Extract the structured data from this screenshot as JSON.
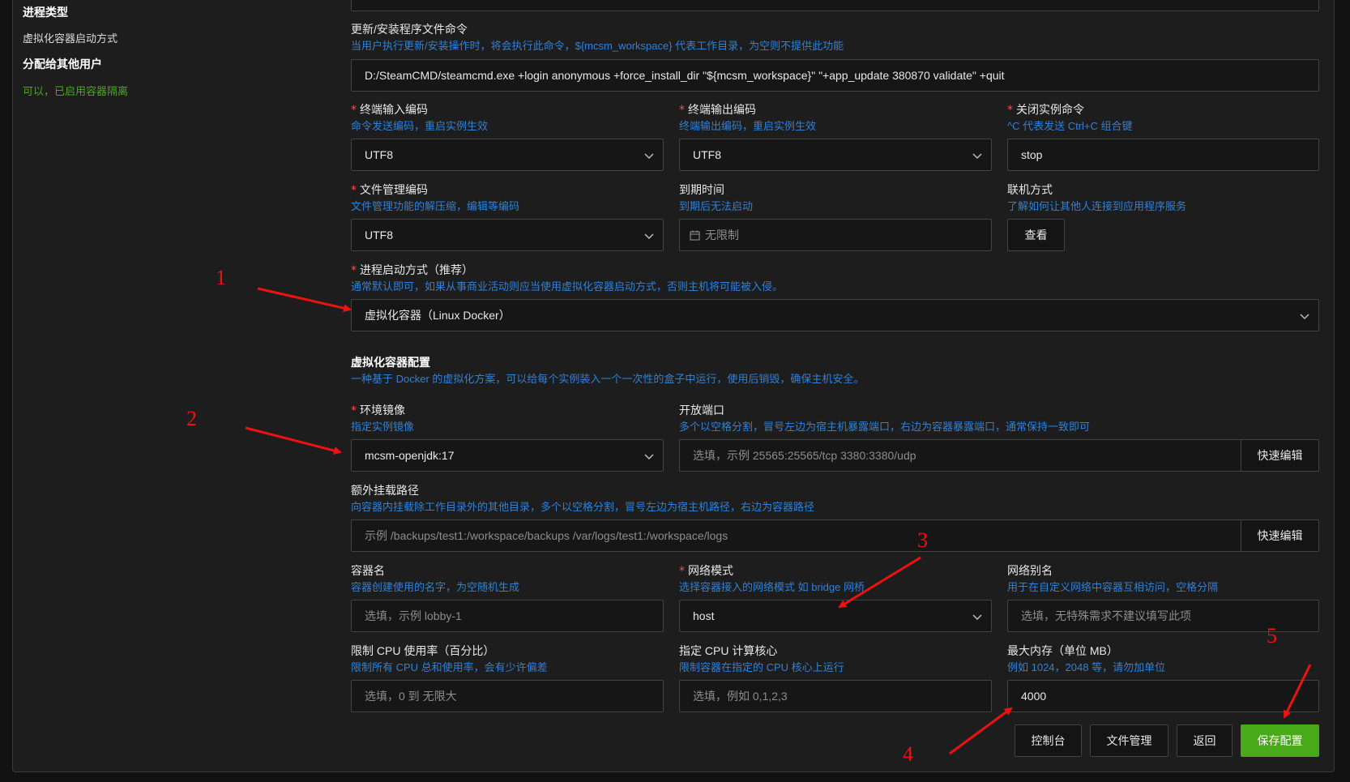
{
  "sidebar": {
    "process_type_heading": "进程类型",
    "process_type_value": "虚拟化容器启动方式",
    "assign_heading": "分配给其他用户",
    "assign_value": "可以，已启用容器隔离"
  },
  "update_cmd": {
    "label": "更新/安装程序文件命令",
    "hint": "当用户执行更新/安装操作时，将会执行此命令，${mcsm_workspace} 代表工作目录，为空则不提供此功能",
    "value": "D:/SteamCMD/steamcmd.exe +login anonymous +force_install_dir \"${mcsm_workspace}\" \"+app_update 380870 validate\" +quit"
  },
  "input_encoding": {
    "required_mark": "*",
    "label": "终端输入编码",
    "hint": "命令发送编码，重启实例生效",
    "value": "UTF8"
  },
  "output_encoding": {
    "required_mark": "*",
    "label": "终端输出编码",
    "hint": "终端输出编码，重启实例生效",
    "value": "UTF8"
  },
  "stop_cmd": {
    "required_mark": "*",
    "label": "关闭实例命令",
    "hint": "^C 代表发送 Ctrl+C 组合键",
    "value": "stop"
  },
  "file_encoding": {
    "required_mark": "*",
    "label": "文件管理编码",
    "hint": "文件管理功能的解压缩，编辑等编码",
    "value": "UTF8"
  },
  "expire": {
    "label": "到期时间",
    "hint": "到期后无法启动",
    "value": "无限制",
    "icon": "calendar-icon"
  },
  "connect": {
    "label": "联机方式",
    "hint": "了解如何让其他人连接到应用程序服务",
    "button": "查看"
  },
  "start_mode": {
    "required_mark": "*",
    "label": "进程启动方式（推荐）",
    "hint": "通常默认即可，如果从事商业活动则应当使用虚拟化容器启动方式，否则主机将可能被入侵。",
    "value": "虚拟化容器（Linux Docker）"
  },
  "docker_section": {
    "title": "虚拟化容器配置",
    "hint": "一种基于 Docker 的虚拟化方案，可以给每个实例装入一个一次性的盒子中运行，使用后销毁，确保主机安全。"
  },
  "image": {
    "required_mark": "*",
    "label": "环境镜像",
    "hint": "指定实例镜像",
    "value": "mcsm-openjdk:17"
  },
  "ports": {
    "label": "开放端口",
    "hint": "多个以空格分割，冒号左边为宿主机暴露端口，右边为容器暴露端口，通常保持一致即可",
    "placeholder": "选填，示例 25565:25565/tcp 3380:3380/udp",
    "button": "快速编辑"
  },
  "mounts": {
    "label": "额外挂载路径",
    "hint": "向容器内挂载除工作目录外的其他目录，多个以空格分割，冒号左边为宿主机路径，右边为容器路径",
    "placeholder": "示例 /backups/test1:/workspace/backups /var/logs/test1:/workspace/logs",
    "button": "快速编辑"
  },
  "container_name": {
    "label": "容器名",
    "hint": "容器创建使用的名字，为空随机生成",
    "placeholder": "选填，示例 lobby-1"
  },
  "network_mode": {
    "required_mark": "*",
    "label": "网络模式",
    "hint": "选择容器接入的网络模式 如 bridge 网桥",
    "value": "host"
  },
  "network_alias": {
    "label": "网络别名",
    "hint": "用于在自定义网络中容器互相访问，空格分隔",
    "placeholder": "选填，无特殊需求不建议填写此项"
  },
  "cpu_limit": {
    "label": "限制 CPU 使用率（百分比）",
    "hint": "限制所有 CPU 总和使用率，会有少许偏差",
    "placeholder": "选填，0 到 无限大"
  },
  "cpu_cores": {
    "label": "指定 CPU 计算核心",
    "hint": "限制容器在指定的 CPU 核心上运行",
    "placeholder": "选填，例如 0,1,2,3"
  },
  "memory": {
    "label": "最大内存（单位 MB）",
    "hint": "例如 1024，2048 等，请勿加单位",
    "value": "4000"
  },
  "actions": {
    "console": "控制台",
    "files": "文件管理",
    "back": "返回",
    "save": "保存配置"
  },
  "annotations": [
    "1",
    "2",
    "3",
    "4",
    "5"
  ],
  "colors": {
    "primary": "#49aa19",
    "hint": "#2f80d8",
    "required": "#ff4d4f",
    "annotation": "#e11111"
  }
}
